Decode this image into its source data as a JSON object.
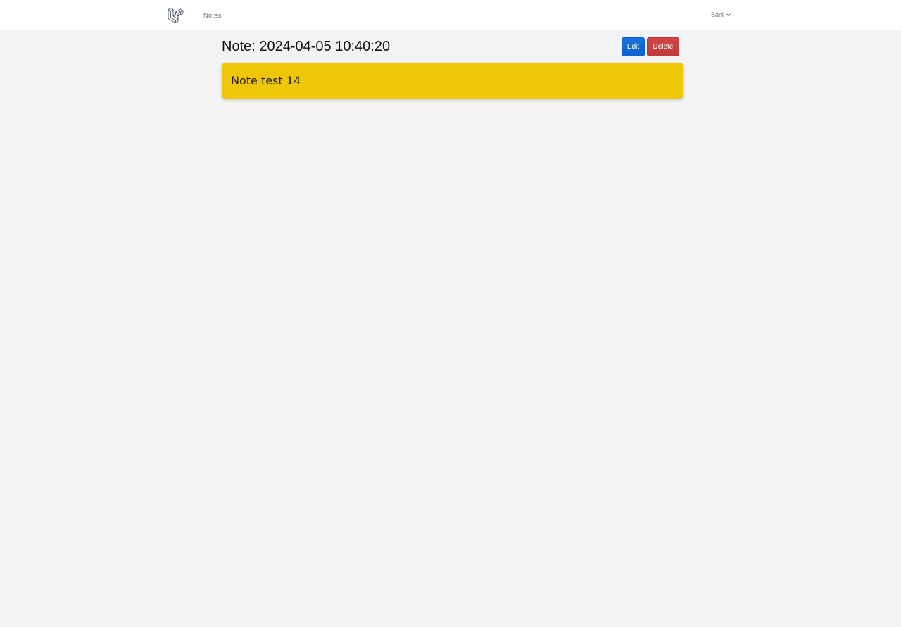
{
  "nav": {
    "logo_icon": "laravel-logo-icon",
    "notes_link": "Notes",
    "user_name": "Sani",
    "user_menu_icon": "chevron-down-icon"
  },
  "page": {
    "title": "Note: 2024-04-05 10:40:20"
  },
  "actions": {
    "edit_label": "Edit",
    "delete_label": "Delete",
    "edit_color": "#0d6efd",
    "delete_color": "#c93c3c"
  },
  "note": {
    "text": "Note test 14",
    "background": "#efc708"
  }
}
